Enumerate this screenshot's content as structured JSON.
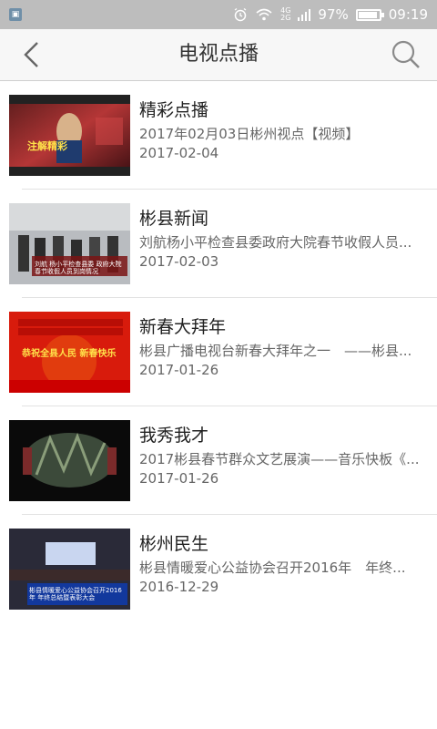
{
  "status_bar": {
    "network_top": "4G",
    "network_bottom": "2G",
    "battery": "97%",
    "time": "09:19"
  },
  "header": {
    "title": "电视点播"
  },
  "items": [
    {
      "title": "精彩点播",
      "subtitle": "2017年02月03日彬州视点【视频】",
      "date": "2017-02-04",
      "thumb_caption": "注解精彩"
    },
    {
      "title": "彬县新闻",
      "subtitle": "刘航杨小平检查县委政府大院春节收假人员...",
      "date": "2017-02-03",
      "thumb_caption": "刘航 杨小平检查县委 政府大院春节收假人员到岗情况"
    },
    {
      "title": "新春大拜年",
      "subtitle": "彬县广播电视台新春大拜年之一　——彬县...",
      "date": "2017-01-26",
      "thumb_caption": "恭祝全县人民 新春快乐"
    },
    {
      "title": "我秀我才",
      "subtitle": "2017彬县春节群众文艺展演——音乐快板《...",
      "date": "2017-01-26",
      "thumb_caption": ""
    },
    {
      "title": "彬州民生",
      "subtitle": "彬县情暖爱心公益协会召开2016年　年终...",
      "date": "2016-12-29",
      "thumb_caption": "彬县情暖爱心公益协会召开2016年 年终总结暨表彰大会"
    }
  ]
}
